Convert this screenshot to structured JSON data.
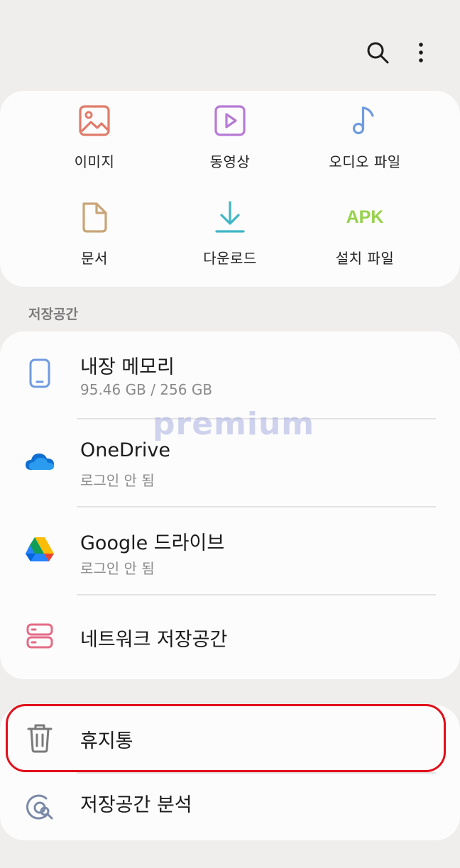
{
  "categories": [
    {
      "label": "이미지",
      "icon": "image-icon"
    },
    {
      "label": "동영상",
      "icon": "video-icon"
    },
    {
      "label": "오디오 파일",
      "icon": "music-note-icon"
    },
    {
      "label": "문서",
      "icon": "document-icon"
    },
    {
      "label": "다운로드",
      "icon": "download-icon"
    },
    {
      "label": "설치 파일",
      "icon": "apk-icon",
      "icon_text": "APK"
    }
  ],
  "storage_section_label": "저장공간",
  "storage": [
    {
      "title": "내장 메모리",
      "subtitle": "95.46 GB / 256 GB"
    },
    {
      "title": "OneDrive",
      "subtitle": "로그인 안 됨"
    },
    {
      "title": "Google 드라이브",
      "subtitle": "로그인 안 됨"
    },
    {
      "title": "네트워크 저장공간"
    }
  ],
  "bottom": [
    {
      "title": "휴지통"
    },
    {
      "title": "저장공간 분석"
    }
  ],
  "watermark": "premium",
  "colors": {
    "background": "#efeeec",
    "card": "#fcfcfc",
    "highlight": "#e0101a",
    "image_icon": "#e07b6a",
    "video_icon": "#b67ad6",
    "audio_icon": "#6f9be0",
    "doc_icon": "#c9a577",
    "download_icon": "#3fb6c7",
    "apk_icon": "#97d24c",
    "network_icon": "#e46b86"
  }
}
